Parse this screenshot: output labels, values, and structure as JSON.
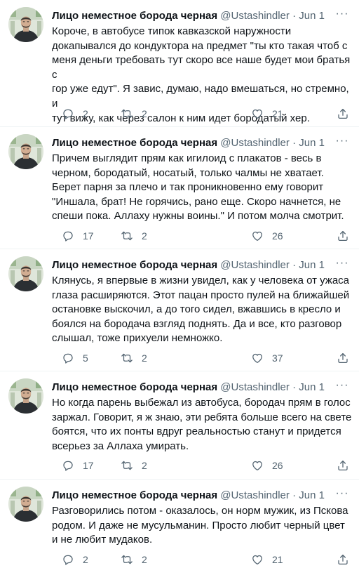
{
  "tweets": [
    {
      "name": "Лицо неместное борода черная",
      "handle": "@Ustashindler",
      "separator": "·",
      "date": "Jun 1",
      "more": "···",
      "lines": [
        "Короче, в автобусе типок кавказской наружности",
        "докапывался до кондуктора на предмет \"ты кто такая чтоб с",
        "меня деньги требовать тут скоро все наше будет мои братья с",
        "гор уже едут\". Я завис, думаю, надо вмешаться, но стремно, и",
        "тут вижу, как через салон к ним идет бородатый хер."
      ],
      "replies": "2",
      "retweets": "2",
      "likes": "21"
    },
    {
      "name": "Лицо неместное борода черная",
      "handle": "@Ustashindler",
      "separator": "·",
      "date": "Jun 1",
      "more": "···",
      "lines": [
        "Причем выглядит прям как игилоид с плакатов - весь в",
        "черном, бородатый, носатый, только чалмы не хватает.",
        "Берет парня за плечо и так проникновенно ему говорит",
        "\"Иншала, брат! Не горячись, рано еще. Скоро начнется, не",
        "спеши пока. Аллаху нужны воины.\" И потом молча смотрит."
      ],
      "replies": "17",
      "retweets": "2",
      "likes": "26"
    },
    {
      "name": "Лицо неместное борода черная",
      "handle": "@Ustashindler",
      "separator": "·",
      "date": "Jun 1",
      "more": "···",
      "lines": [
        "Клянусь, я впервые в жизни увидел, как у человека от ужаса",
        "глаза расширяются. Этот пацан просто пулей на ближайшей",
        "остановке выскочил, а до того сидел, вжавшись в кресло и",
        "боялся на бородача взгляд поднять. Да и все, кто разговор",
        "слышал, тоже прихуели немножко."
      ],
      "replies": "5",
      "retweets": "2",
      "likes": "37"
    },
    {
      "name": "Лицо неместное борода черная",
      "handle": "@Ustashindler",
      "separator": "·",
      "date": "Jun 1",
      "more": "···",
      "lines": [
        "Но когда парень выбежал из автобуса, бородач прям в голос",
        "заржал. Говорит, я ж знаю, эти ребята больше всего на свете",
        "боятся, что их понты вдруг реальностью станут и придется",
        "всерьез за Аллаха умирать."
      ],
      "replies": "17",
      "retweets": "2",
      "likes": "26"
    },
    {
      "name": "Лицо неместное борода черная",
      "handle": "@Ustashindler",
      "separator": "·",
      "date": "Jun 1",
      "more": "···",
      "lines": [
        "Разговорились потом - оказалось, он норм мужик, из Пскова",
        "родом. И даже не мусульманин. Просто любит черный цвет",
        "и не любит мудаков."
      ],
      "replies": "2",
      "retweets": "2",
      "likes": "21"
    }
  ],
  "colors": {
    "text": "#0f1419",
    "secondary": "#536471",
    "divider": "#eff3f4"
  },
  "icons": [
    "avatar-photo",
    "more-icon",
    "reply-icon",
    "retweet-icon",
    "like-icon",
    "share-icon"
  ]
}
